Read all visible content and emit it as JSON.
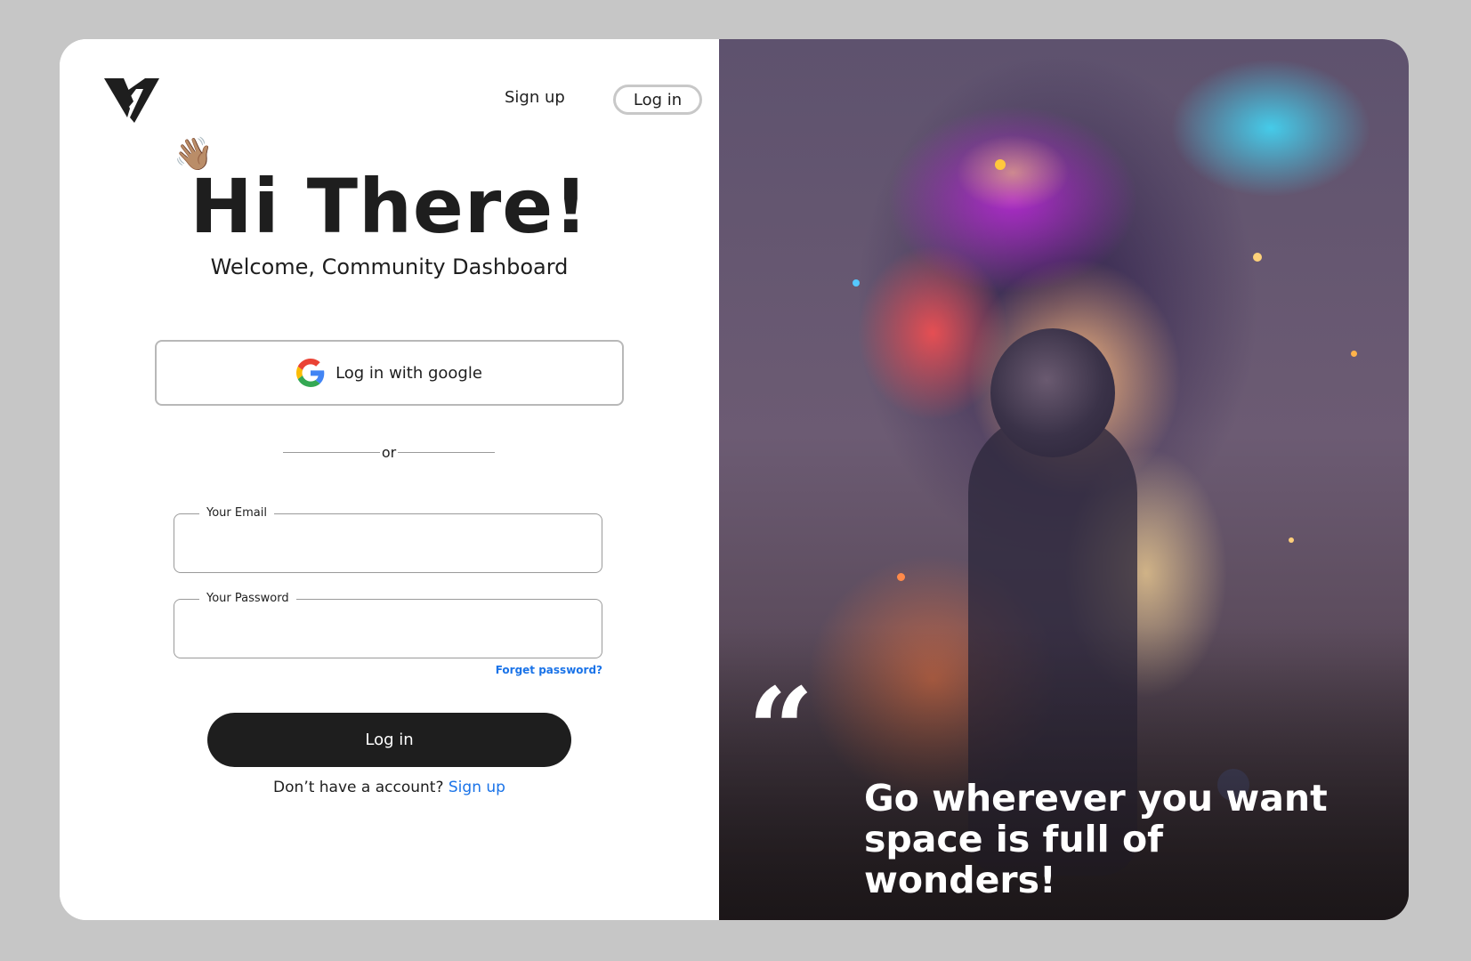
{
  "nav": {
    "signup_label": "Sign up",
    "login_label": "Log in"
  },
  "hero": {
    "wave_emoji": "👋🏽",
    "headline": "Hi There!",
    "subtitle": "Welcome, Community Dashboard"
  },
  "google": {
    "label": "Log in with google",
    "icon": "google-icon"
  },
  "divider": {
    "label": "or"
  },
  "form": {
    "email": {
      "label": "Your Email",
      "value": "",
      "placeholder": ""
    },
    "password": {
      "label": "Your Password",
      "value": "",
      "placeholder": ""
    },
    "forget_label": "Forget password?",
    "submit_label": "Log in",
    "no_account_text": "Don’t have a account?",
    "signup_link": "Sign up"
  },
  "quote": {
    "mark": "“",
    "line1": "Go wherever you want",
    "line2": "space is full of wonders!"
  },
  "colors": {
    "background": "#c6c6c6",
    "primary": "#1e1e1e",
    "link": "#1a73e8",
    "border": "#b8b8b8"
  }
}
